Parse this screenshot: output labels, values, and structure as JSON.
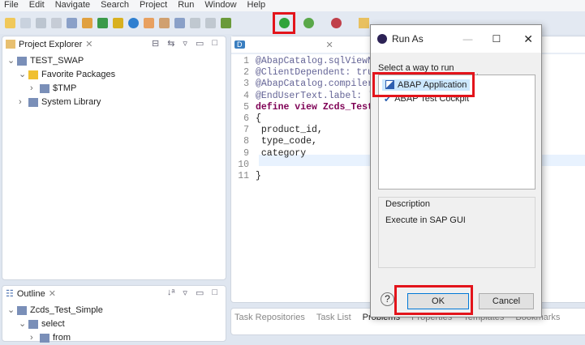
{
  "menu": [
    "File",
    "Edit",
    "Navigate",
    "Search",
    "Project",
    "Run",
    "Window",
    "Help"
  ],
  "project_explorer": {
    "title": "Project Explorer",
    "tree": [
      {
        "label": "TEST_SWAP",
        "level": 0,
        "icon": "project-icon",
        "expand": "v"
      },
      {
        "label": "Favorite Packages",
        "level": 1,
        "icon": "star-icon",
        "expand": "v"
      },
      {
        "label": "$TMP",
        "level": 2,
        "icon": "package-icon",
        "expand": ">"
      },
      {
        "label": "System Library",
        "level": 1,
        "icon": "library-icon",
        "expand": ">"
      }
    ]
  },
  "outline": {
    "title": "Outline",
    "tree": [
      {
        "label": "Zcds_Test_Simple",
        "level": 0,
        "expand": "v"
      },
      {
        "label": "select",
        "level": 1,
        "expand": "v"
      },
      {
        "label": "from",
        "level": 2,
        "expand": ">"
      }
    ]
  },
  "editor": {
    "lines": [
      {
        "n": "1",
        "text": "@AbapCatalog.sqlViewN",
        "cls": "ann"
      },
      {
        "n": "2",
        "text": "@ClientDependent: tru",
        "cls": "ann"
      },
      {
        "n": "3",
        "text": "@AbapCatalog.compiler",
        "cls": "ann"
      },
      {
        "n": "4",
        "text": "@EndUserText.label: '",
        "cls": "ann"
      },
      {
        "n": "5",
        "text": "define view Zcds_Test",
        "cls": "kw"
      },
      {
        "n": "6",
        "text": "{",
        "cls": ""
      },
      {
        "n": "7",
        "text": " product_id,",
        "cls": ""
      },
      {
        "n": "8",
        "text": " type_code,",
        "cls": ""
      },
      {
        "n": "9",
        "text": " category",
        "cls": ""
      },
      {
        "n": "10",
        "text": "",
        "cls": ""
      },
      {
        "n": "11",
        "text": "}",
        "cls": ""
      }
    ]
  },
  "bottom_tabs": [
    "Task Repositories",
    "Task List",
    "Problems",
    "Properties",
    "Templates",
    "Bookmarks"
  ],
  "dialog": {
    "title": "Run As",
    "prompt": "Select a way to run 'zcds_test_simple.asddls':",
    "options": [
      "ABAP Application",
      "ABAP Test Cockpit"
    ],
    "description_label": "Description",
    "description": "Execute in SAP GUI",
    "ok": "OK",
    "cancel": "Cancel",
    "help": "?"
  },
  "colors": {
    "highlight": "#e3141b",
    "selection": "#cce8ff"
  }
}
